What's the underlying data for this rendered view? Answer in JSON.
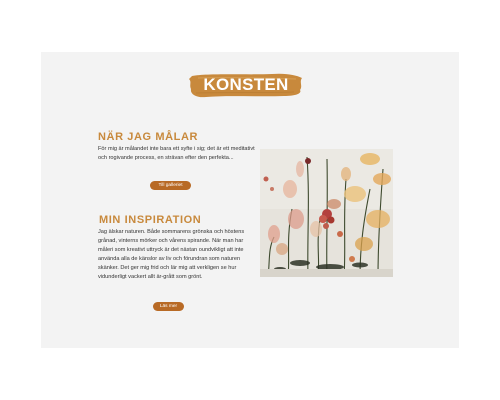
{
  "section": {
    "title": "KONSTEN",
    "accent_color": "#c8893c",
    "button_color": "#b86a25",
    "background_color": "#f3f3f3"
  },
  "blocks": [
    {
      "heading": "NÄR JAG MÅLAR",
      "text": "För mig är målandet inte bara ett syfte i sig; det är ett meditativt och rogivande process, en strävan efter den perfekta...",
      "button_label": "Till galleriet"
    },
    {
      "heading": "MIN INSPIRATION",
      "text": "Jag älskar naturen. Både sommarens grönska och höstens grånad, vinterns mörker och vårens spirande. När man har måleri som kreativt uttryck är det nästan oundvikligt att inte använda alla de känslor av liv och förundran som naturen skänker. Det ger mig frid och lär mig att verkligen se hur vidunderligt vackert allt är-grått som grönt.",
      "button_label": "Läs mer"
    }
  ],
  "artwork": {
    "icon": "botanical-painting"
  }
}
